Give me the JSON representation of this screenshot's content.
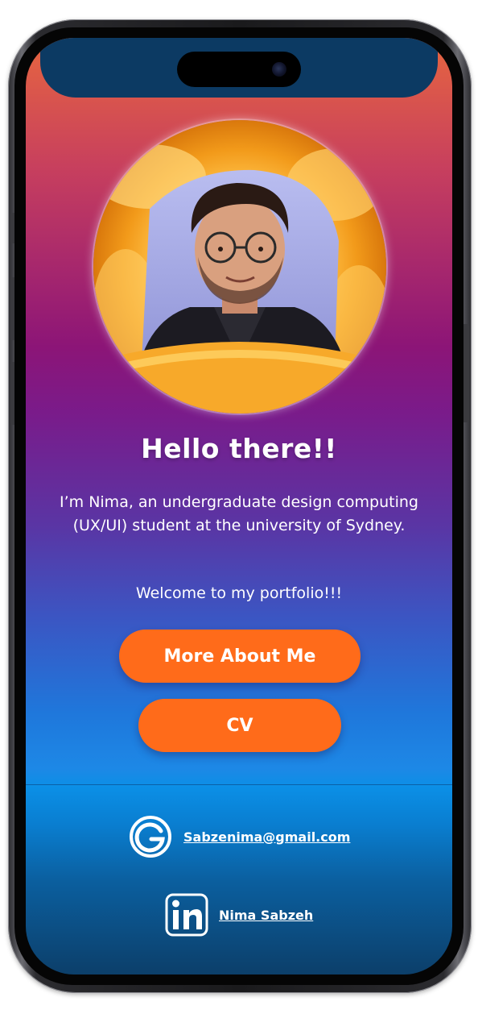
{
  "profile": {
    "heading": "Hello there!!",
    "intro": "I’m Nima, an undergraduate design computing (UX/UI) student at the university of Sydney.",
    "welcome": "Welcome to my portfolio!!!"
  },
  "actions": {
    "about_label": "More About Me",
    "cv_label": "CV"
  },
  "contact": {
    "email": "Sabzenima@gmail.com",
    "email_icon": "gmail-g-icon",
    "linkedin_name": "Nima Sabzeh",
    "linkedin_icon": "linkedin-icon"
  },
  "colors": {
    "accent_orange": "#ff6b1a",
    "gradient_top": "#e7663f",
    "gradient_mid": "#8c1577",
    "gradient_blue": "#1f77db",
    "gradient_bottom": "#0c3f6a"
  }
}
